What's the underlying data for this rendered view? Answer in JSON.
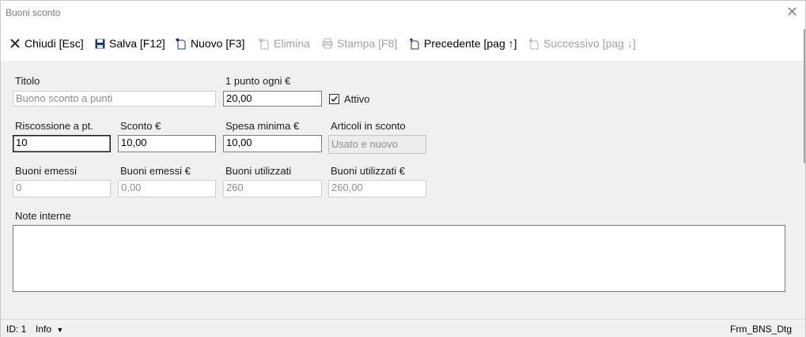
{
  "window": {
    "title": "Buoni sconto"
  },
  "toolbar": {
    "close_label": "Chiudi [Esc]",
    "save_label": "Salva [F12]",
    "new_label": "Nuovo [F3]",
    "delete_label": "Elimina",
    "print_label": "Stampa [F8]",
    "prev_label": "Precedente [pag ↑]",
    "next_label": "Successivo [pag ↓]"
  },
  "form": {
    "titolo": {
      "label": "Titolo",
      "placeholder": "Buono sconto a punti"
    },
    "punto_ogni": {
      "label": "1 punto ogni €",
      "value": "20,00"
    },
    "attivo": {
      "label": "Attivo",
      "checked": true
    },
    "riscossione": {
      "label": "Riscossione a pt.",
      "value": "10"
    },
    "sconto": {
      "label": "Sconto €",
      "value": "10,00"
    },
    "spesa_minima": {
      "label": "Spesa minima €",
      "value": "10,00"
    },
    "articoli": {
      "label": "Articoli in sconto",
      "value": "Usato e nuovo"
    },
    "buoni_emessi": {
      "label": "Buoni emessi",
      "value": "0"
    },
    "buoni_emessi_eur": {
      "label": "Buoni emessi €",
      "value": "0,00"
    },
    "buoni_utilizzati": {
      "label": "Buoni utilizzati",
      "value": "260"
    },
    "buoni_utilizzati_eur": {
      "label": "Buoni utilizzati €",
      "value": "260,00"
    },
    "note": {
      "label": "Note interne",
      "value": ""
    }
  },
  "status": {
    "id": "ID: 1",
    "info": "Info",
    "form_name": "Frm_BNS_Dtg"
  },
  "colors": {
    "accent": "#1c3a6b",
    "disabled": "#a3a3a3"
  },
  "icons": {
    "close": "close-x-icon",
    "save": "floppy-disk-icon",
    "new": "new-document-icon",
    "delete": "delete-document-icon",
    "print": "print-icon",
    "prev": "previous-document-icon",
    "next": "next-document-icon"
  }
}
